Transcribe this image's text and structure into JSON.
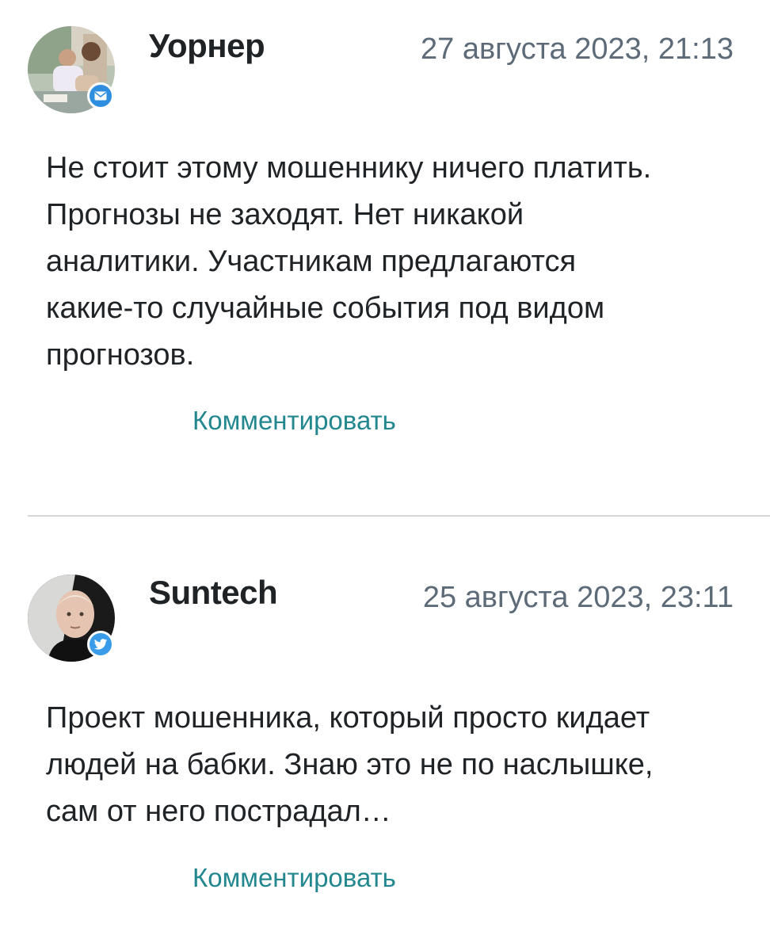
{
  "comments": [
    {
      "author": "Уорнер",
      "date": "27 августа 2023, 21:13",
      "source_icon": "mail-icon",
      "text": "Не стоит этому мошеннику ничего платить.\nПрогнозы не заходят. Нет никакой\nаналитики. Участникам предлагаются\nкакие-то случайные события под видом\nпрогнозов.",
      "reply_label": "Комментировать"
    },
    {
      "author": "Suntech",
      "date": "25 августа 2023, 23:11",
      "source_icon": "twitter-bird-icon",
      "text": "Проект мошенника, который просто кидает\nлюдей на бабки. Знаю это не по наслышке,\nсам от него пострадал…",
      "reply_label": "Комментировать"
    }
  ],
  "colors": {
    "author": "#1f2326",
    "date": "#5d6b78",
    "link": "#23878f",
    "badge": "#2f8de0",
    "divider": "#d4d7da"
  }
}
